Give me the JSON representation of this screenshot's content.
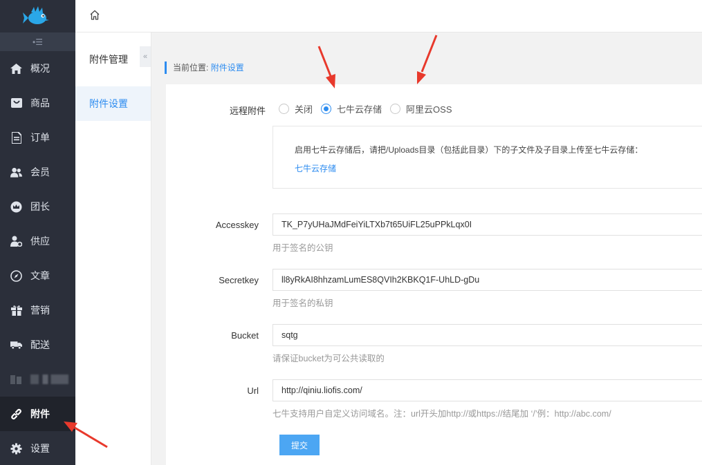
{
  "sidebar": {
    "collapse_glyph": "•☰",
    "items": [
      {
        "label": "概况",
        "icon": "home-icon"
      },
      {
        "label": "商品",
        "icon": "shopping-bag-icon"
      },
      {
        "label": "订单",
        "icon": "document-icon"
      },
      {
        "label": "会员",
        "icon": "users-icon"
      },
      {
        "label": "团长",
        "icon": "crown-icon"
      },
      {
        "label": "供应",
        "icon": "supplier-icon"
      },
      {
        "label": "文章",
        "icon": "compass-icon"
      },
      {
        "label": "营销",
        "icon": "gift-icon"
      },
      {
        "label": "配送",
        "icon": "truck-icon"
      },
      {
        "label": "",
        "icon": "blurred-icon"
      },
      {
        "label": "附件",
        "icon": "link-icon",
        "active": true
      },
      {
        "label": "设置",
        "icon": "gear-icon"
      }
    ]
  },
  "submenu": {
    "title": "附件管理",
    "collapse_glyph": "«",
    "items": [
      {
        "label": "附件设置",
        "active": true
      }
    ]
  },
  "breadcrumb": {
    "prefix": "当前位置:",
    "current": "附件设置"
  },
  "form": {
    "remote": {
      "label": "远程附件",
      "options": [
        {
          "label": "关闭",
          "checked": false
        },
        {
          "label": "七牛云存储",
          "checked": true
        },
        {
          "label": "阿里云OSS",
          "checked": false
        }
      ]
    },
    "notice": {
      "text": "启用七牛云存储后，请把/Uploads目录（包括此目录）下的子文件及子目录上传至七牛云存储：",
      "link": "七牛云存储"
    },
    "accesskey": {
      "label": "Accesskey",
      "value": "TK_P7yUHaJMdFeiYiLTXb7t65UiFL25uPPkLqx0I",
      "hint": "用于签名的公钥"
    },
    "secretkey": {
      "label": "Secretkey",
      "value": "ll8yRkAI8hhzamLumES8QVIh2KBKQ1F-UhLD-gDu",
      "hint": "用于签名的私钥"
    },
    "bucket": {
      "label": "Bucket",
      "value": "sqtg",
      "hint": "请保证bucket为可公共读取的"
    },
    "url": {
      "label": "Url",
      "value": "http://qiniu.liofis.com/",
      "hint": "七牛支持用户自定义访问域名。注：url开头加http://或https://结尾加 ‘/’例：http://abc.com/"
    },
    "submit_label": "提交"
  },
  "colors": {
    "sidebar_bg": "#2b2f3a",
    "accent": "#2d8cf0",
    "submit_bg": "#4ca6f3",
    "annotation_arrow": "#e8392c"
  }
}
